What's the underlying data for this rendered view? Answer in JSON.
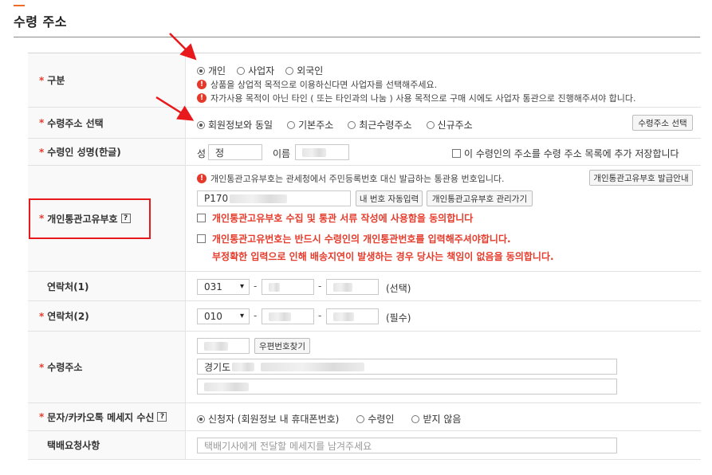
{
  "section": {
    "title": "수령 주소"
  },
  "colors": {
    "accent": "#f06b24",
    "required": "#e53b2b",
    "warning": "#e5392b",
    "highlight": "#e8191c"
  },
  "rows": {
    "category": {
      "label": "구분",
      "required": true,
      "options": [
        "개인",
        "사업자",
        "외국인"
      ],
      "selected": "개인",
      "notes": [
        "상품을 상업적 목적으로 이용하신다면 사업자를 선택해주세요.",
        "자가사용 목적이 아닌 타인 ( 또는 타인과의 나눔 ) 사용 목적으로 구매 시에도 사업자 통관으로 진행해주셔야 합니다."
      ]
    },
    "address_select": {
      "label": "수령주소 선택",
      "required": true,
      "options": [
        "회원정보와 동일",
        "기본주소",
        "최근수령주소",
        "신규주소"
      ],
      "selected": "회원정보와 동일",
      "button_label": "수령주소 선택"
    },
    "recipient_name": {
      "label": "수령인 성명(한글)",
      "required": true,
      "surname_label": "성",
      "surname_value": "정",
      "given_label": "이름",
      "save_label": "이 수령인의 주소를 수령 주소 목록에 추가 저장합니다"
    },
    "customs_code": {
      "label": "개인통관고유부호",
      "required": true,
      "help_icon": "?",
      "notice": "개인통관고유부호는 관세청에서 주민등록번호 대신 발급하는 통관용 번호입니다.",
      "guide_button": "개인통관고유부호 발급안내",
      "value_prefix": "P170",
      "auto_button": "내 번호 자동입력",
      "manage_button": "개인통관고유부호 관리가기",
      "consent1": "개인통관고유부호 수집 및 통관 서류 작성에 사용함을 동의합니다",
      "consent2_line1": "개인통관고유번호는 반드시 수령인의 개인통관번호를 입력해주셔야합니다.",
      "consent2_line2": "부정확한 입력으로 인해 배송지연이 발생하는 경우 당사는 책임이 없음을 동의합니다."
    },
    "phone1": {
      "label": "연락처(1)",
      "required": false,
      "prefix": "031",
      "dash": "-",
      "suffix_note": "(선택)"
    },
    "phone2": {
      "label": "연락처(2)",
      "required": true,
      "prefix": "010",
      "dash": "-",
      "suffix_note": "(필수)"
    },
    "address": {
      "label": "수령주소",
      "required": true,
      "zip_button": "우편번호찾기",
      "addr1_prefix": "경기도"
    },
    "sms": {
      "label": "문자/카카오톡 메세지 수신",
      "required": true,
      "help_icon": "?",
      "options": [
        "신청자 (회원정보 내 휴대폰번호)",
        "수령인",
        "받지 않음"
      ],
      "selected": "신청자 (회원정보 내 휴대폰번호)"
    },
    "delivery_request": {
      "label": "택배요청사항",
      "required": false,
      "placeholder": "택배기사에게 전달할 메세지를 남겨주세요"
    }
  },
  "icons": {
    "required_mark": "*",
    "warning": "!",
    "caret": "▾"
  }
}
